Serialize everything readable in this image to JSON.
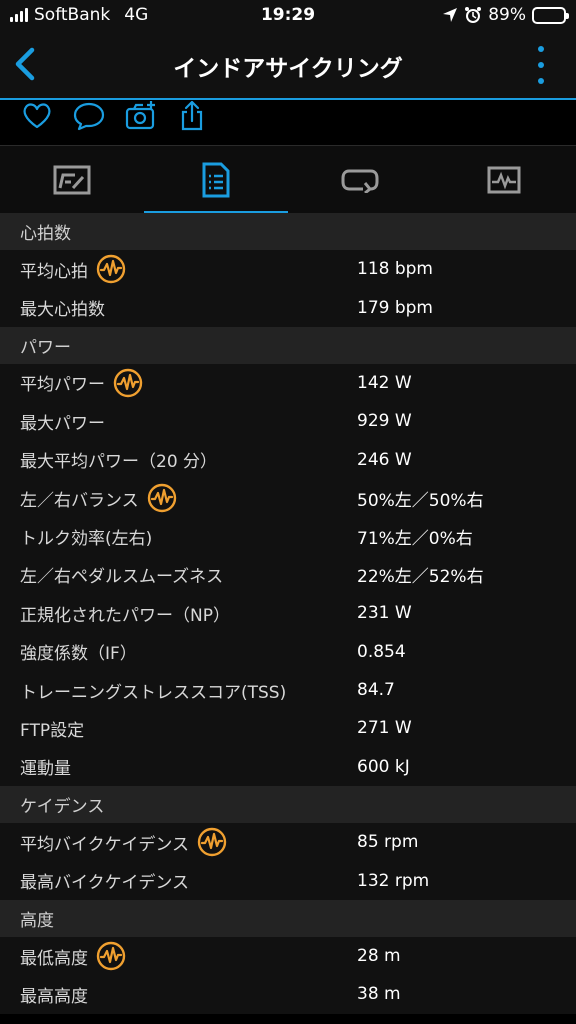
{
  "status_bar": {
    "carrier": "SoftBank",
    "network": "4G",
    "time": "19:29",
    "battery": "89%",
    "battery_level": 0.89
  },
  "nav": {
    "title": "インドアサイクリング"
  },
  "icons": {
    "back": "chevron-left-icon",
    "more": "vertical-ellipsis-icon",
    "actions": [
      "heart-icon",
      "comment-icon",
      "camera-add-icon",
      "share-icon"
    ],
    "tabs": [
      "chart-tab-icon",
      "details-tab-icon",
      "laps-tab-icon",
      "graph-tab-icon"
    ],
    "info": "heart-wave-badge-icon"
  },
  "colors": {
    "accent": "#1a9de0",
    "badge": "#f0a030"
  },
  "sections": [
    {
      "title": "心拍数",
      "rows": [
        {
          "label": "平均心拍",
          "value": "118 bpm",
          "badge": true
        },
        {
          "label": "最大心拍数",
          "value": "179 bpm",
          "badge": false
        }
      ]
    },
    {
      "title": "パワー",
      "rows": [
        {
          "label": "平均パワー",
          "value": "142 W",
          "badge": true
        },
        {
          "label": "最大パワー",
          "value": "929 W",
          "badge": false
        },
        {
          "label": "最大平均パワー（20 分）",
          "value": "246 W",
          "badge": false
        },
        {
          "label": "左／右バランス",
          "value": "50%左／50%右",
          "badge": true
        },
        {
          "label": "トルク効率(左右)",
          "value": "71%左／0%右",
          "badge": false
        },
        {
          "label": "左／右ペダルスムーズネス",
          "value": "22%左／52%右",
          "badge": false
        },
        {
          "label": "正規化されたパワー（NP）",
          "value": "231 W",
          "badge": false
        },
        {
          "label": "強度係数（IF）",
          "value": "0.854",
          "badge": false
        },
        {
          "label": "トレーニングストレススコア(TSS)",
          "value": "84.7",
          "badge": false
        },
        {
          "label": "FTP設定",
          "value": "271 W",
          "badge": false
        },
        {
          "label": "運動量",
          "value": "600 kJ",
          "badge": false
        }
      ]
    },
    {
      "title": "ケイデンス",
      "rows": [
        {
          "label": "平均バイクケイデンス",
          "value": "85 rpm",
          "badge": true
        },
        {
          "label": "最高バイクケイデンス",
          "value": "132 rpm",
          "badge": false
        }
      ]
    },
    {
      "title": "高度",
      "rows": [
        {
          "label": "最低高度",
          "value": "28 m",
          "badge": true
        },
        {
          "label": "最高高度",
          "value": "38 m",
          "badge": false
        }
      ]
    }
  ]
}
